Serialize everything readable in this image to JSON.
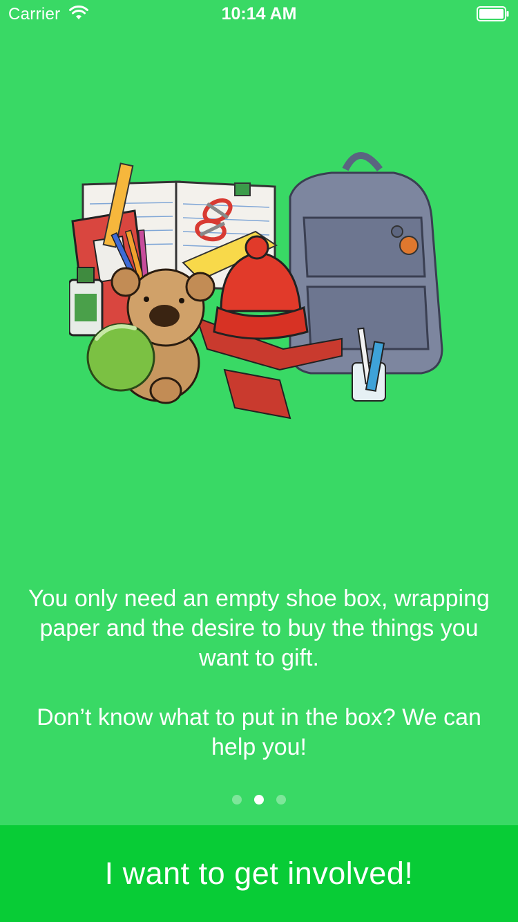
{
  "status_bar": {
    "carrier": "Carrier",
    "time": "10:14 AM",
    "wifi_icon": "wifi-icon",
    "battery_icon": "battery-full-icon"
  },
  "illustration": {
    "icon": "gift-items-illustration"
  },
  "onboarding": {
    "paragraph1": "You only need an empty shoe box, wrapping paper and the desire to buy the things you want to gift.",
    "paragraph2": "Don’t know what to put in the box? We can help you!",
    "page_count": 3,
    "current_page": 2
  },
  "cta": {
    "label": "I want to get involved!"
  },
  "colors": {
    "background": "#39d965",
    "cta_background": "#08cc36",
    "text": "#ffffff"
  }
}
